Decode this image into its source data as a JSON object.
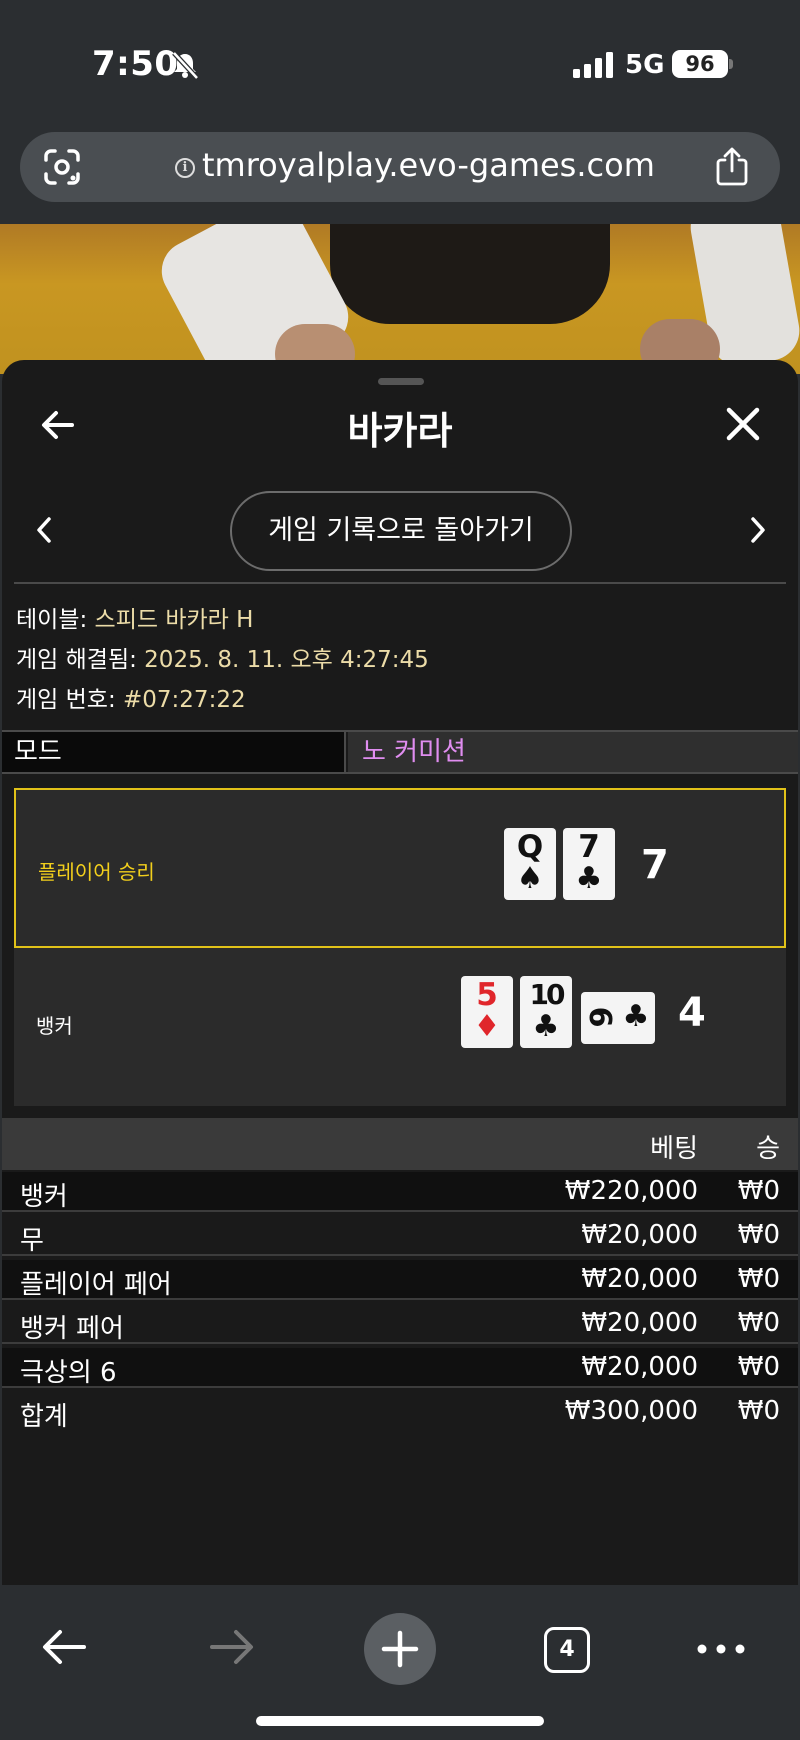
{
  "status": {
    "time": "7:50",
    "network": "5G",
    "battery": "96"
  },
  "browser": {
    "url": "tmroyalplay.evo-games.com",
    "open_tabs": "4"
  },
  "sheet": {
    "title": "바카라",
    "history_button": "게임 기록으로 돌아가기",
    "table_label": "테이블: ",
    "table_value": "스피드 바카라 H",
    "resolved_label": "게임 해결됨: ",
    "resolved_value": "2025. 8. 11. 오후 4:27:45",
    "game_no_label": "게임 번호: ",
    "game_no_value": "#07:27:22",
    "mode_label": "모드",
    "mode_value": "노 커미션"
  },
  "result": {
    "player": {
      "label": "플레이어 승리",
      "score": "7",
      "cards": [
        {
          "rank": "Q",
          "suit": "♠",
          "color": "black"
        },
        {
          "rank": "7",
          "suit": "♣",
          "color": "black"
        }
      ]
    },
    "banker": {
      "label": "뱅커",
      "score": "4",
      "cards": [
        {
          "rank": "5",
          "suit": "♦",
          "color": "red"
        },
        {
          "rank": "10",
          "suit": "♣",
          "color": "black"
        },
        {
          "rank": "9",
          "suit": "♣",
          "color": "black",
          "orientation": "sideways"
        }
      ]
    }
  },
  "bets": {
    "headers": {
      "bet": "베팅",
      "win": "승"
    },
    "rows": [
      {
        "name": "뱅커",
        "amount": "₩220,000",
        "win": "₩0"
      },
      {
        "name": "무",
        "amount": "₩20,000",
        "win": "₩0"
      },
      {
        "name": "플레이어 페어",
        "amount": "₩20,000",
        "win": "₩0"
      },
      {
        "name": "뱅커 페어",
        "amount": "₩20,000",
        "win": "₩0"
      },
      {
        "name": "극상의 6",
        "amount": "₩20,000",
        "win": "₩0"
      }
    ],
    "total": {
      "name": "합계",
      "amount": "₩300,000",
      "win": "₩0"
    }
  },
  "colors": {
    "player_win_accent": "#e1c219",
    "mode_value": "#e08df0",
    "meta_value": "#ecdca8",
    "red_suit": "#e0262b"
  }
}
